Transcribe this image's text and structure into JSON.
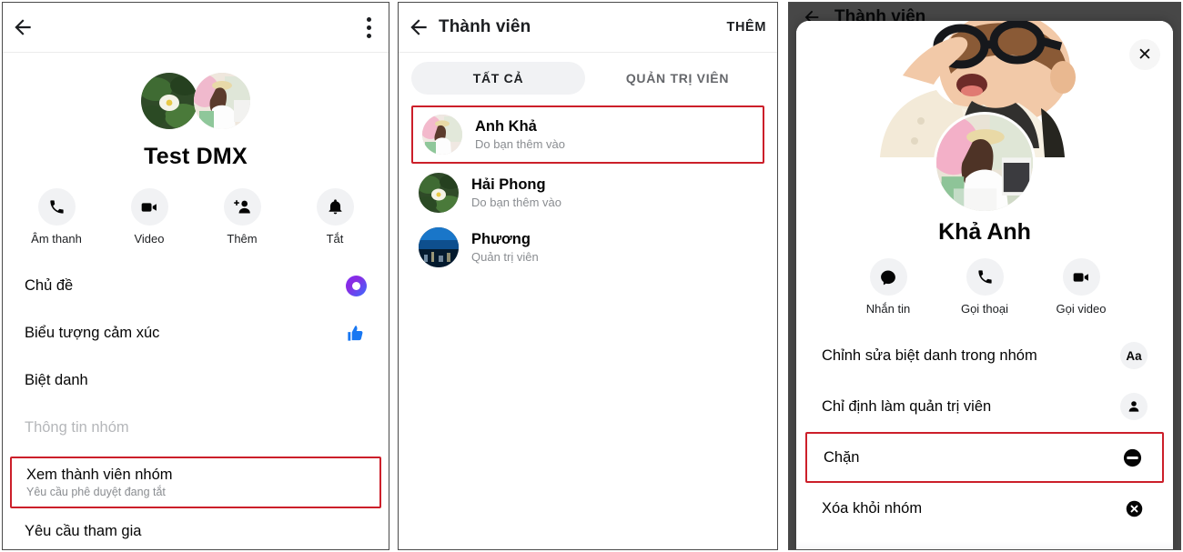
{
  "panel1": {
    "appbar": {
      "back": "back-arrow",
      "menu": "overflow-menu"
    },
    "group": {
      "name": "Test DMX",
      "avatar_a": "lotus-flower-photo",
      "avatar_b": "woman-in-white-photo"
    },
    "quick_actions": [
      {
        "label": "Âm thanh",
        "icon": "phone-icon"
      },
      {
        "label": "Video",
        "icon": "video-camera-icon"
      },
      {
        "label": "Thêm",
        "icon": "add-person-icon"
      },
      {
        "label": "Tắt",
        "icon": "bell-icon"
      }
    ],
    "rows": [
      {
        "title": "Chủ đề",
        "sub": "",
        "icon": "theme-color-dot",
        "muted": false,
        "highlighted": false
      },
      {
        "title": "Biểu tượng cảm xúc",
        "sub": "",
        "icon": "thumbs-up-icon",
        "muted": false,
        "highlighted": false
      },
      {
        "title": "Biệt danh",
        "sub": "",
        "icon": "",
        "muted": false,
        "highlighted": false
      },
      {
        "title": "Thông tin nhóm",
        "sub": "",
        "icon": "",
        "muted": true,
        "highlighted": false
      },
      {
        "title": "Xem thành viên nhóm",
        "sub": "Yêu cầu phê duyệt đang tắt",
        "icon": "",
        "muted": false,
        "highlighted": true
      }
    ],
    "cutoff_row": "Yêu cầu tham gia"
  },
  "panel2": {
    "appbar": {
      "title": "Thành viên",
      "action": "THÊM"
    },
    "tabs": [
      {
        "label": "TẤT CẢ",
        "active": true
      },
      {
        "label": "QUẢN TRỊ VIÊN",
        "active": false
      }
    ],
    "members": [
      {
        "name": "Anh Khả",
        "sub": "Do bạn thêm vào",
        "avatar": "woman-in-white-photo",
        "highlighted": true
      },
      {
        "name": "Hải Phong",
        "sub": "Do bạn thêm vào",
        "avatar": "lotus-flower-photo",
        "highlighted": false
      },
      {
        "name": "Phương",
        "sub": "Quản trị viên",
        "avatar": "night-cityscape-photo",
        "highlighted": false
      }
    ]
  },
  "panel3": {
    "background_title": "Thành viên",
    "close_label": "✕",
    "profile": {
      "name": "Khả Anh",
      "cover": "baby-with-glasses-photo",
      "avatar": "woman-in-white-photo"
    },
    "actions": [
      {
        "label": "Nhắn tin",
        "icon": "message-bubble-icon"
      },
      {
        "label": "Gọi thoại",
        "icon": "phone-icon"
      },
      {
        "label": "Gọi video",
        "icon": "video-camera-icon"
      }
    ],
    "rows": [
      {
        "title": "Chỉnh sửa biệt danh trong nhóm",
        "icon": "Aa",
        "icon_name": "text-format-icon",
        "highlighted": false
      },
      {
        "title": "Chỉ định làm quản trị viên",
        "icon": "",
        "icon_name": "person-icon",
        "highlighted": false
      },
      {
        "title": "Chặn",
        "icon": "",
        "icon_name": "block-icon",
        "highlighted": true
      },
      {
        "title": "Xóa khỏi nhóm",
        "icon": "",
        "icon_name": "remove-circle-icon",
        "highlighted": false
      }
    ]
  },
  "colors": {
    "highlight": "#cc1f2a",
    "accent_blue": "#1877f2",
    "text_primary": "#050505",
    "text_secondary": "#8a8d91"
  }
}
